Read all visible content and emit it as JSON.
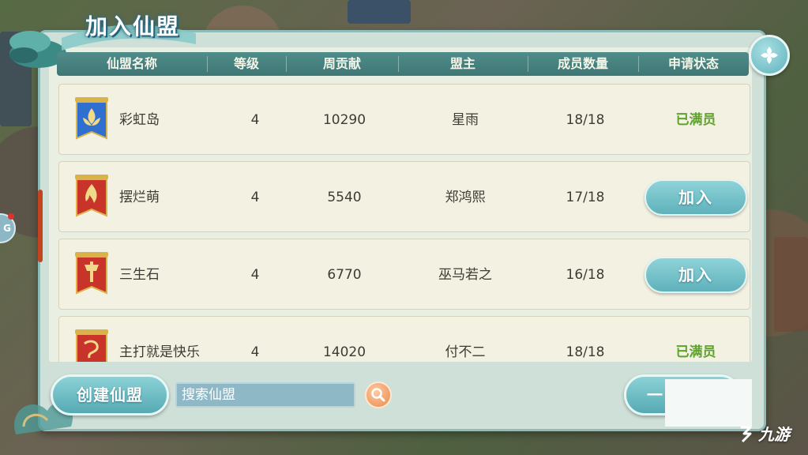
{
  "title": "加入仙盟",
  "columns": {
    "name": "仙盟名称",
    "level": "等级",
    "weekly": "周贡献",
    "leader": "盟主",
    "members": "成员数量",
    "status": "申请状态"
  },
  "rows": [
    {
      "name": "彩虹岛",
      "level": "4",
      "weekly": "10290",
      "leader": "星雨",
      "members": "18/18",
      "status": "已满员",
      "join": "",
      "flag_color": "#2f6fcf",
      "flag_emblem": "lotus-emblem"
    },
    {
      "name": "摆烂萌",
      "level": "4",
      "weekly": "5540",
      "leader": "郑鸿熙",
      "members": "17/18",
      "status": "",
      "join": "加入",
      "flag_color": "#c8332a",
      "flag_emblem": "flame-emblem"
    },
    {
      "name": "三生石",
      "level": "4",
      "weekly": "6770",
      "leader": "巫马若之",
      "members": "16/18",
      "status": "",
      "join": "加入",
      "flag_color": "#c8332a",
      "flag_emblem": "axe-emblem"
    },
    {
      "name": "主打就是快乐",
      "level": "4",
      "weekly": "14020",
      "leader": "付不二",
      "members": "18/18",
      "status": "已满员",
      "join": "",
      "flag_color": "#c8332a",
      "flag_emblem": "dragon-emblem"
    }
  ],
  "footer": {
    "create_label": "创建仙盟",
    "search_placeholder": "搜索仙盟",
    "oneclick_label": "一"
  },
  "side_badge": "G",
  "watermark": "九游",
  "colors": {
    "header": "#4f8c8a",
    "full_status": "#5fa22c",
    "button": "#5fb1bb"
  }
}
